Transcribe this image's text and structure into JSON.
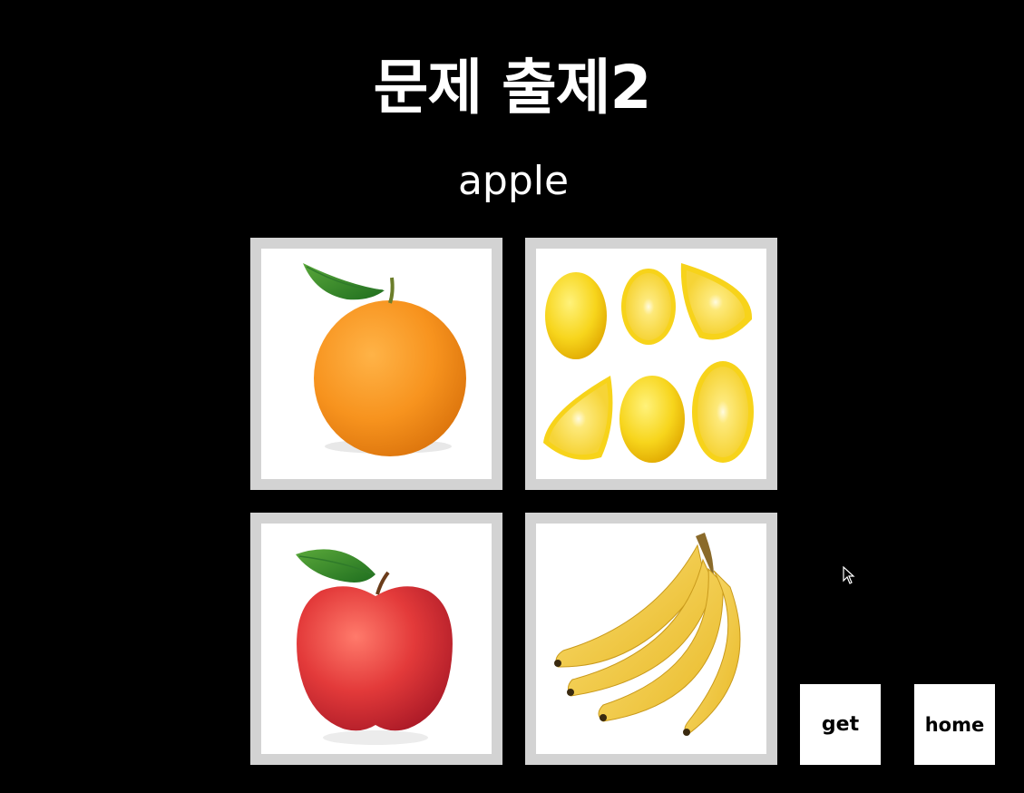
{
  "header": {
    "title": "문제 출제2",
    "target_word": "apple"
  },
  "choices": [
    {
      "fruit": "orange",
      "icon": "orange-image"
    },
    {
      "fruit": "lemon",
      "icon": "lemon-image"
    },
    {
      "fruit": "apple",
      "icon": "apple-image"
    },
    {
      "fruit": "banana",
      "icon": "banana-image"
    }
  ],
  "buttons": {
    "get_label": "get",
    "home_label": "home"
  },
  "colors": {
    "background": "#000000",
    "card_border": "#d3d3d3",
    "text": "#ffffff"
  }
}
